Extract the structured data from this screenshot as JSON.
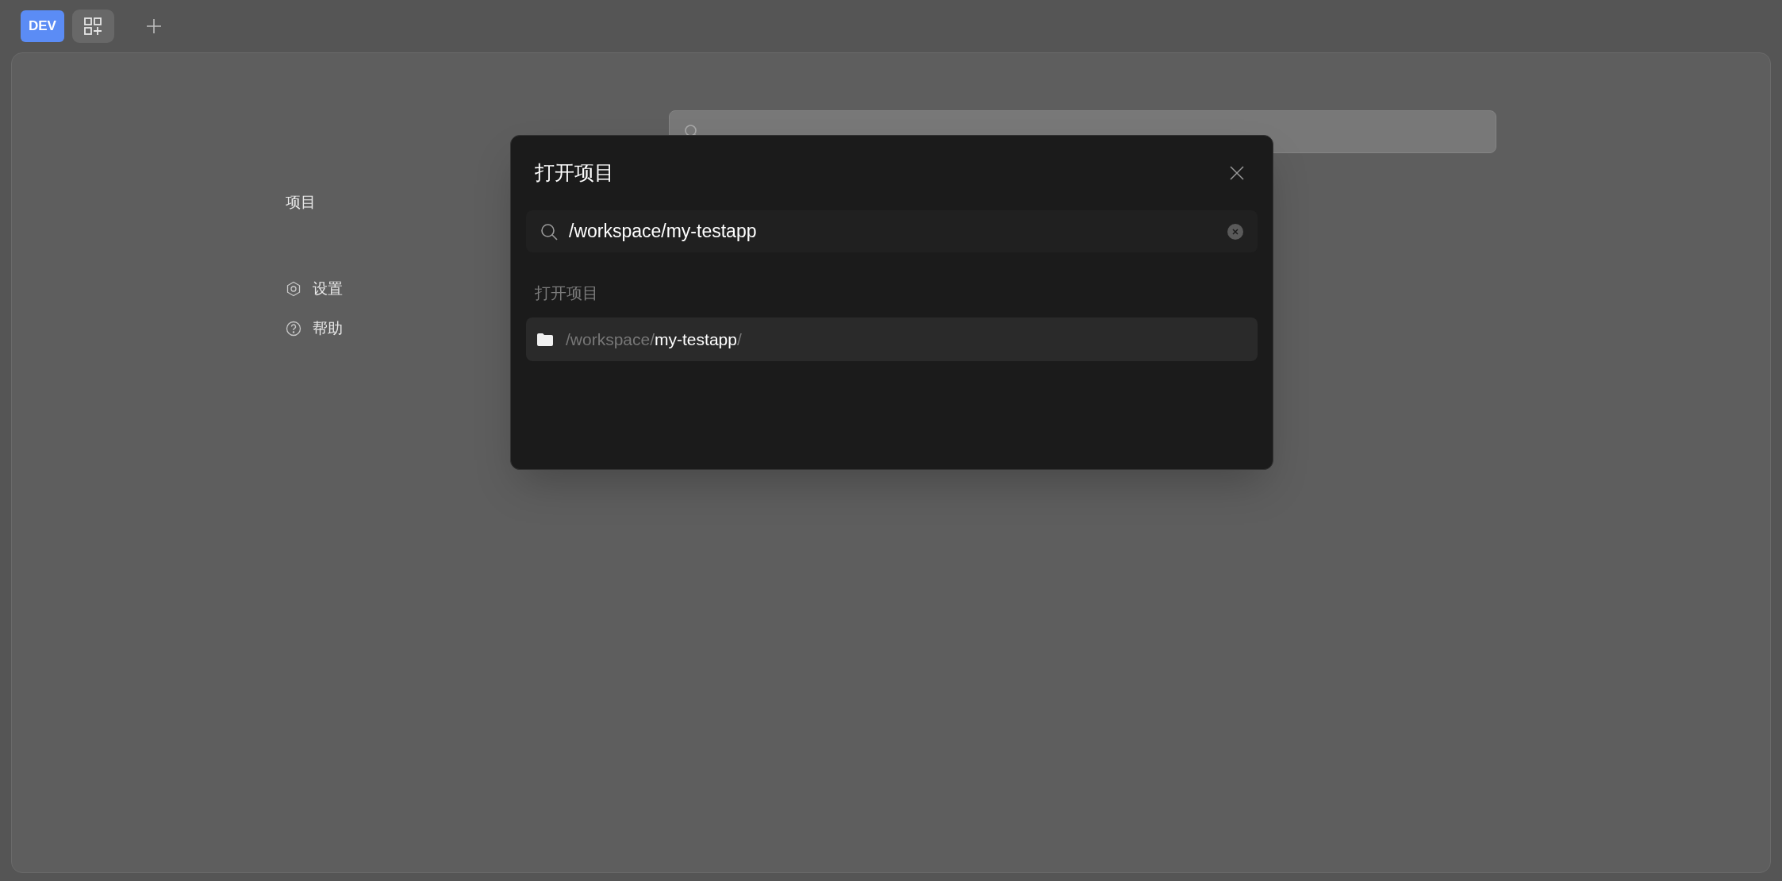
{
  "tab_bar": {
    "env_badge": "DEV"
  },
  "sidebar": {
    "section_title": "项目",
    "items": [
      {
        "kind": "settings",
        "label": "设置"
      },
      {
        "kind": "help",
        "label": "帮助"
      }
    ]
  },
  "dialog": {
    "title": "打开项目",
    "search": {
      "value": "/workspace/my-testapp"
    },
    "section_label": "打开项目",
    "results": [
      {
        "dir": "/workspace/",
        "match": "my-testapp",
        "suffix": "/",
        "selected": true
      }
    ]
  }
}
